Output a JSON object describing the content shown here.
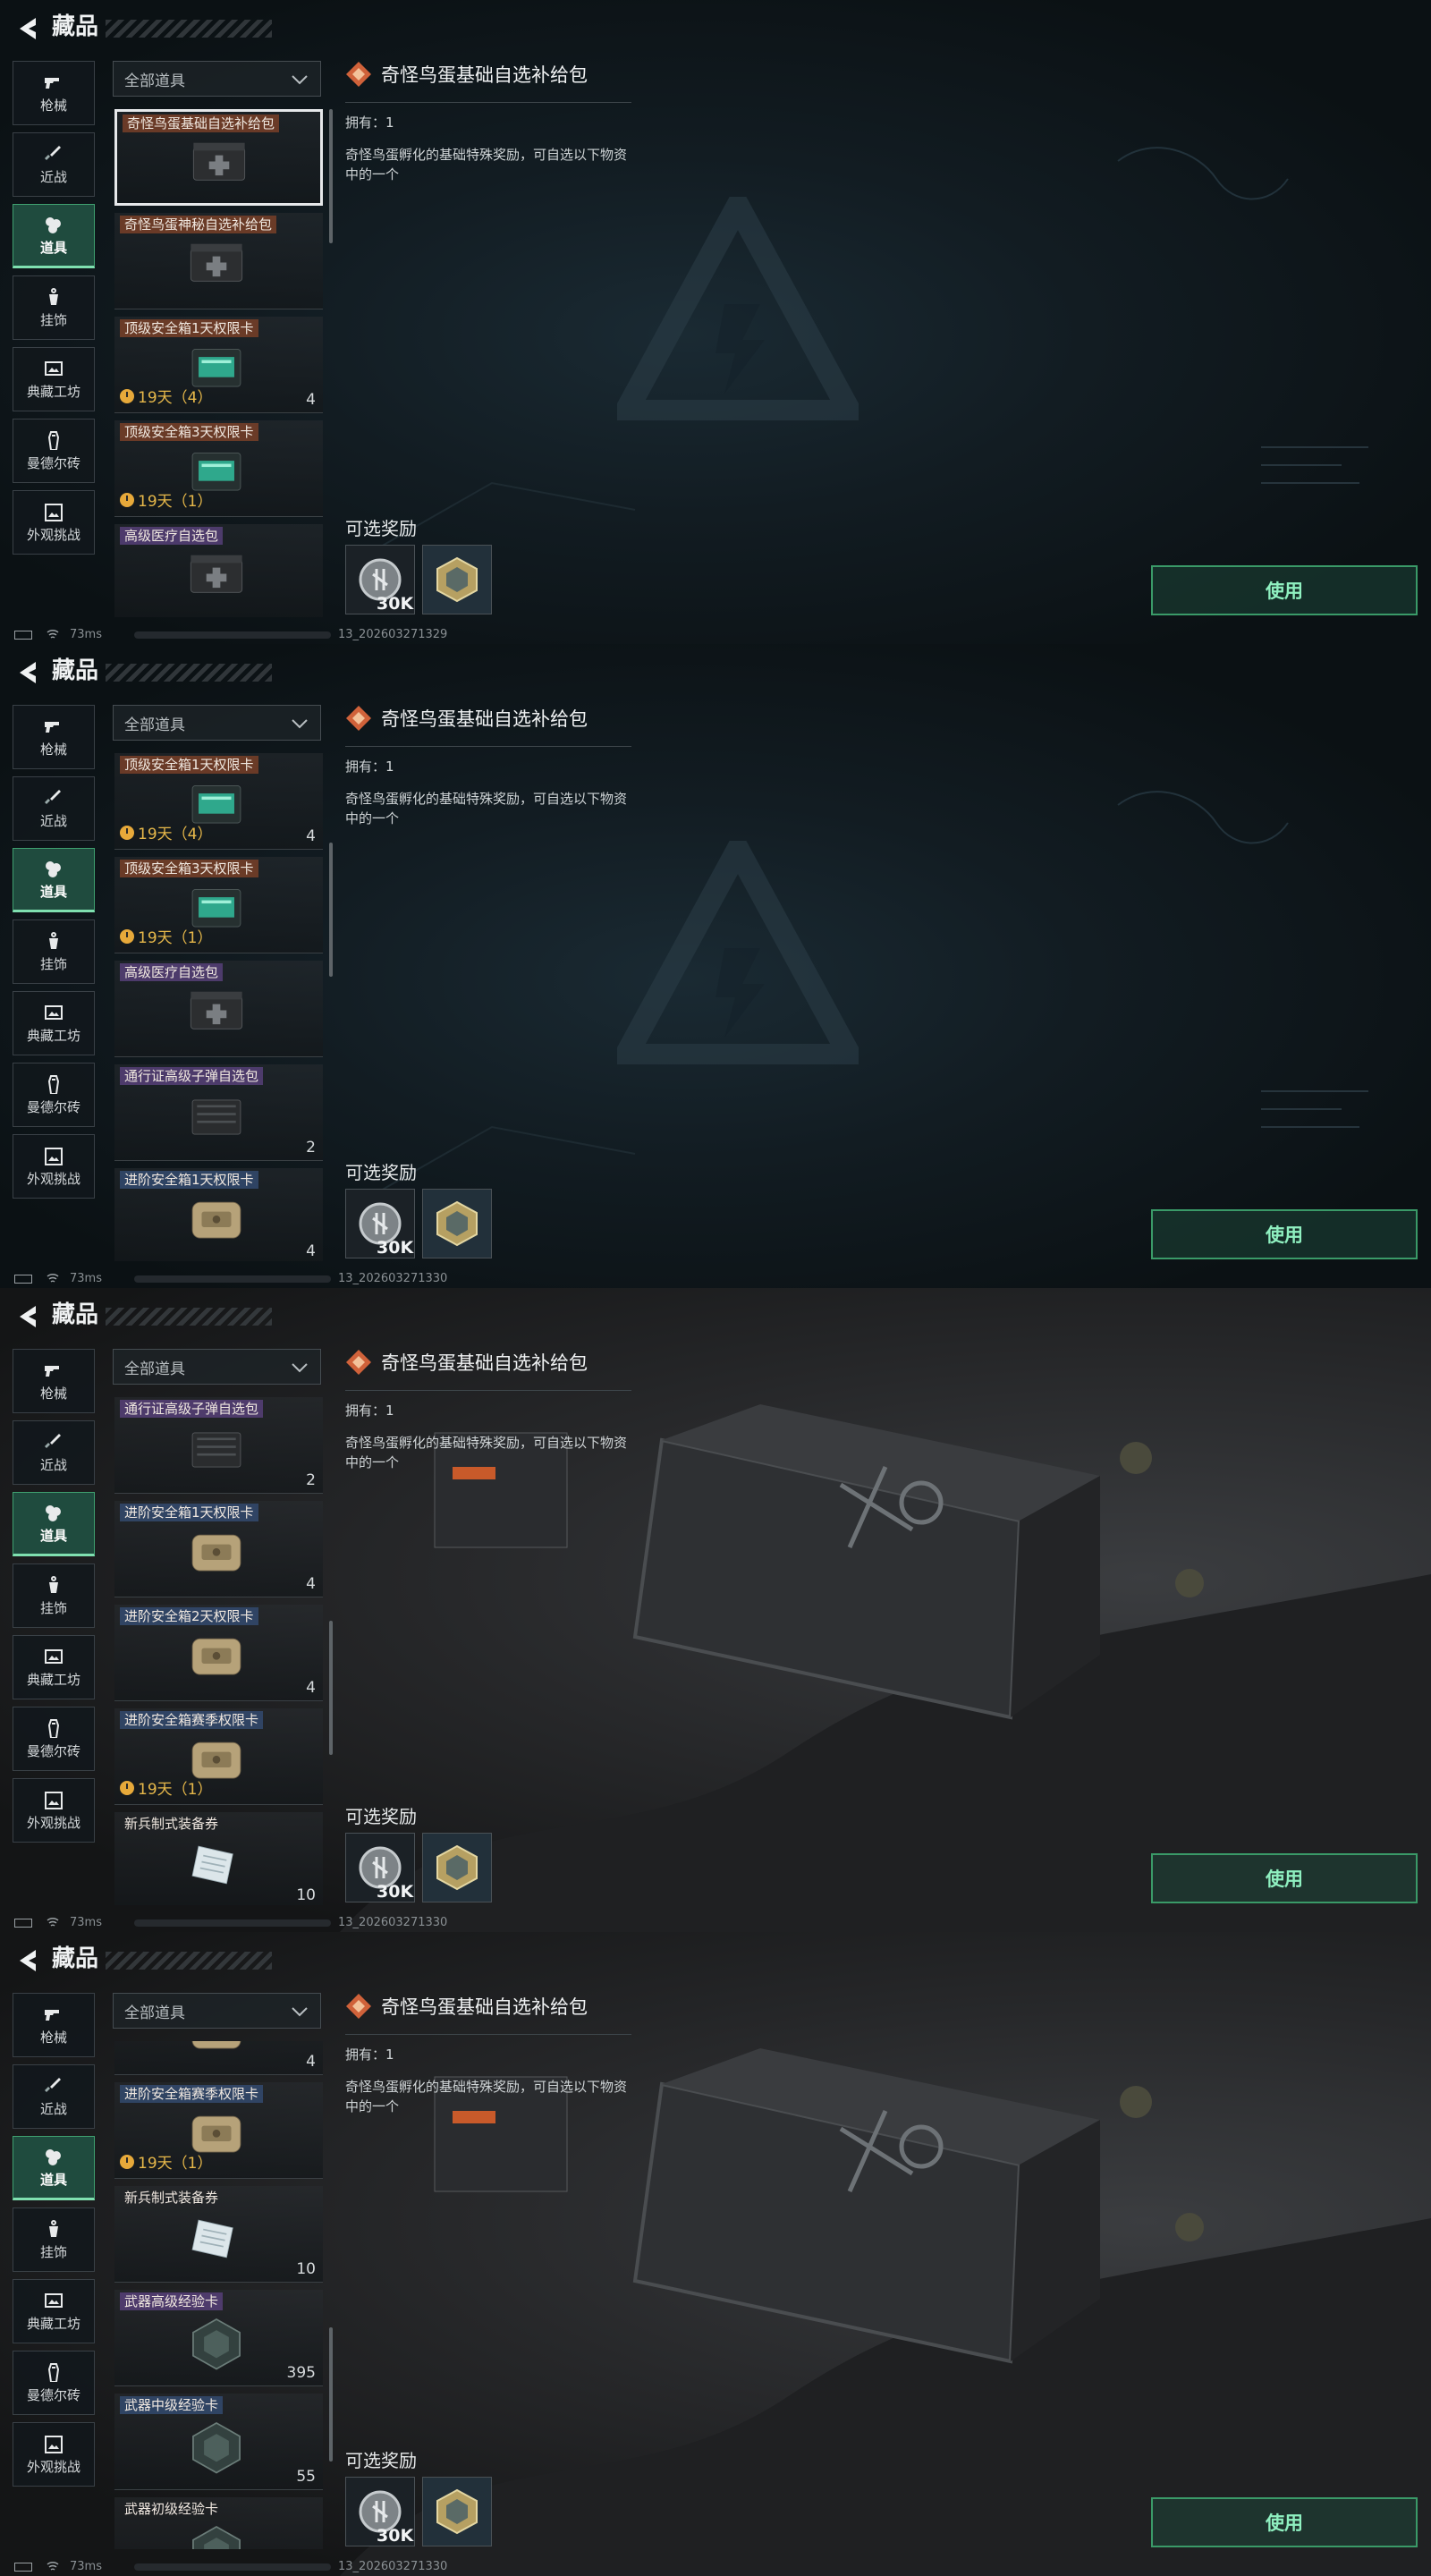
{
  "header": {
    "title": "藏品"
  },
  "categories": [
    {
      "label": "枪械",
      "icon": "pistol-icon"
    },
    {
      "label": "近战",
      "icon": "knife-icon"
    },
    {
      "label": "道具",
      "icon": "grenade-cluster-icon",
      "active": true
    },
    {
      "label": "挂饰",
      "icon": "charm-icon"
    },
    {
      "label": "典藏工坊",
      "icon": "frame-icon"
    },
    {
      "label": "曼德尔砖",
      "icon": "brick-icon"
    },
    {
      "label": "外观挑战",
      "icon": "picture-icon"
    }
  ],
  "filter": {
    "label": "全部道具"
  },
  "items": [
    {
      "name": "奇怪鸟蛋基础自选补给包",
      "tag_color": "orange",
      "qty": "",
      "timer": "",
      "thumb": "medkit-case-icon",
      "selected": true
    },
    {
      "name": "奇怪鸟蛋神秘自选补给包",
      "tag_color": "orange",
      "qty": "",
      "timer": "",
      "thumb": "medkit-case-icon"
    },
    {
      "name": "顶级安全箱1天权限卡",
      "tag_color": "orange",
      "qty": "4",
      "timer": "19天（4）",
      "thumb": "green-safe-icon"
    },
    {
      "name": "顶级安全箱3天权限卡",
      "tag_color": "orange",
      "qty": "",
      "timer": "19天（1）",
      "thumb": "green-safe-icon"
    },
    {
      "name": "高级医疗自选包",
      "tag_color": "purple",
      "qty": "",
      "timer": "",
      "thumb": "medkit-case-icon"
    },
    {
      "name": "通行证高级子弹自选包",
      "tag_color": "purple",
      "qty": "2",
      "timer": "",
      "thumb": "ammo-box-icon"
    },
    {
      "name": "进阶安全箱1天权限卡",
      "tag_color": "blue",
      "qty": "4",
      "timer": "",
      "thumb": "tan-safe-icon"
    },
    {
      "name": "进阶安全箱2天权限卡",
      "tag_color": "blue",
      "qty": "4",
      "timer": "",
      "thumb": "tan-safe-icon"
    },
    {
      "name": "进阶安全箱赛季权限卡",
      "tag_color": "blue",
      "qty": "",
      "timer": "19天（1）",
      "thumb": "tan-safe-icon"
    },
    {
      "name": "新兵制式装备券",
      "tag_color": "none",
      "qty": "10",
      "timer": "",
      "thumb": "voucher-icon"
    },
    {
      "name": "武器高级经验卡",
      "tag_color": "purple",
      "qty": "395",
      "timer": "",
      "thumb": "exp-card-icon"
    },
    {
      "name": "武器中级经验卡",
      "tag_color": "blue",
      "qty": "55",
      "timer": "",
      "thumb": "exp-card-icon"
    },
    {
      "name": "武器初级经验卡",
      "tag_color": "none",
      "qty": "",
      "timer": "",
      "thumb": "exp-card-icon"
    }
  ],
  "detail": {
    "title": "奇怪鸟蛋基础自选补给包",
    "owned": "拥有：1",
    "description": "奇怪鸟蛋孵化的基础特殊奖励，可自选以下物资中的一个",
    "rewards_label": "可选奖励",
    "rewards": [
      {
        "icon": "silver-coin-icon",
        "amount": "30K"
      },
      {
        "icon": "hex-badge-icon",
        "amount": ""
      }
    ],
    "use_label": "使用"
  },
  "panels": [
    {
      "list_scroll": 0,
      "bg": "dark",
      "status": {
        "ping": "73ms",
        "version": "13_202603271329"
      }
    },
    {
      "list_scroll": 2,
      "bg": "dark",
      "status": {
        "ping": "73ms",
        "version": "13_202603271330"
      }
    },
    {
      "list_scroll": 5,
      "bg": "photo",
      "status": {
        "ping": "73ms",
        "version": "13_202603271330"
      }
    },
    {
      "list_scroll": 7.6,
      "bg": "photo",
      "status": {
        "ping": "73ms",
        "version": "13_202603271330"
      }
    }
  ],
  "colors": {
    "accent": "#3fa070",
    "use_text": "#8ff0c0",
    "timer": "#e7b84a"
  }
}
